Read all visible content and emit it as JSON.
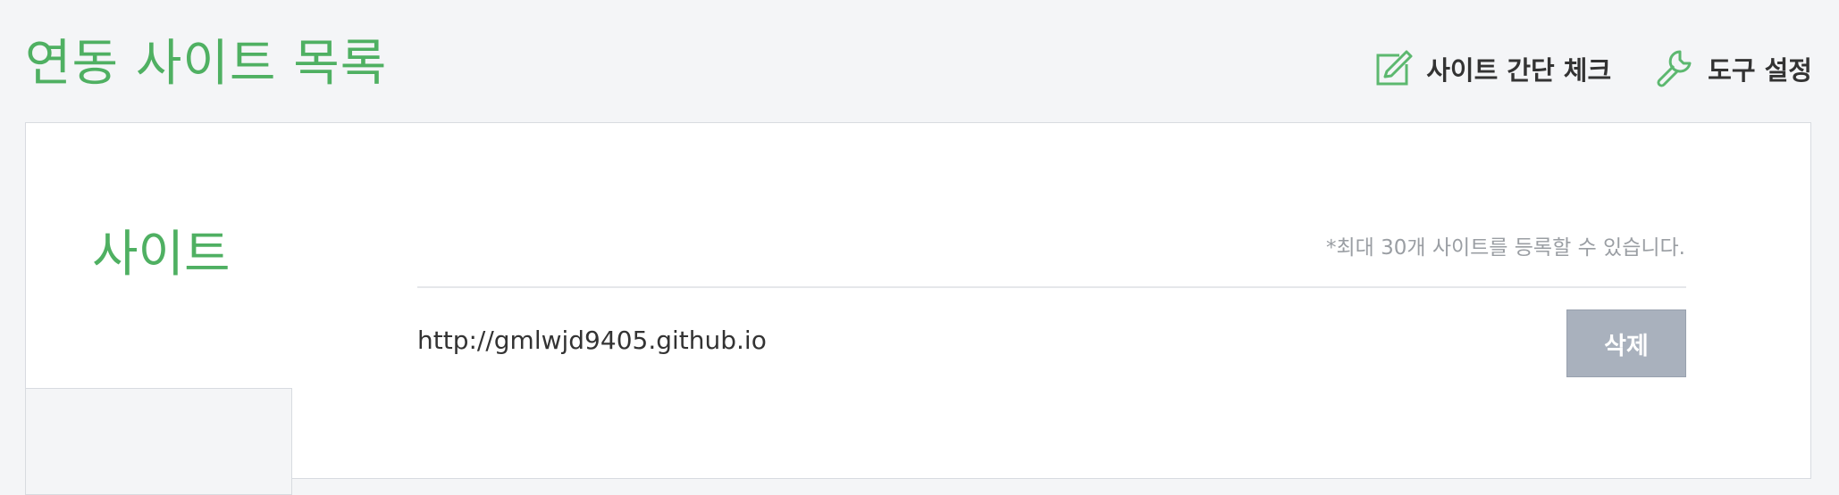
{
  "header": {
    "title": "연동 사이트 목록",
    "actions": [
      {
        "icon": "edit-check-icon",
        "label": "사이트 간단 체크"
      },
      {
        "icon": "wrench-icon",
        "label": "도구 설정"
      }
    ]
  },
  "panel": {
    "section_title": "사이트",
    "note": "*최대 30개 사이트를 등록할 수 있습니다.",
    "sites": [
      {
        "url": "http://gmlwjd9405.github.io",
        "delete_label": "삭제"
      }
    ]
  },
  "colors": {
    "accent": "#4fb062",
    "background": "#f4f5f7",
    "button": "#a9b1bd",
    "text": "#333333",
    "muted": "#9a9ea3"
  }
}
